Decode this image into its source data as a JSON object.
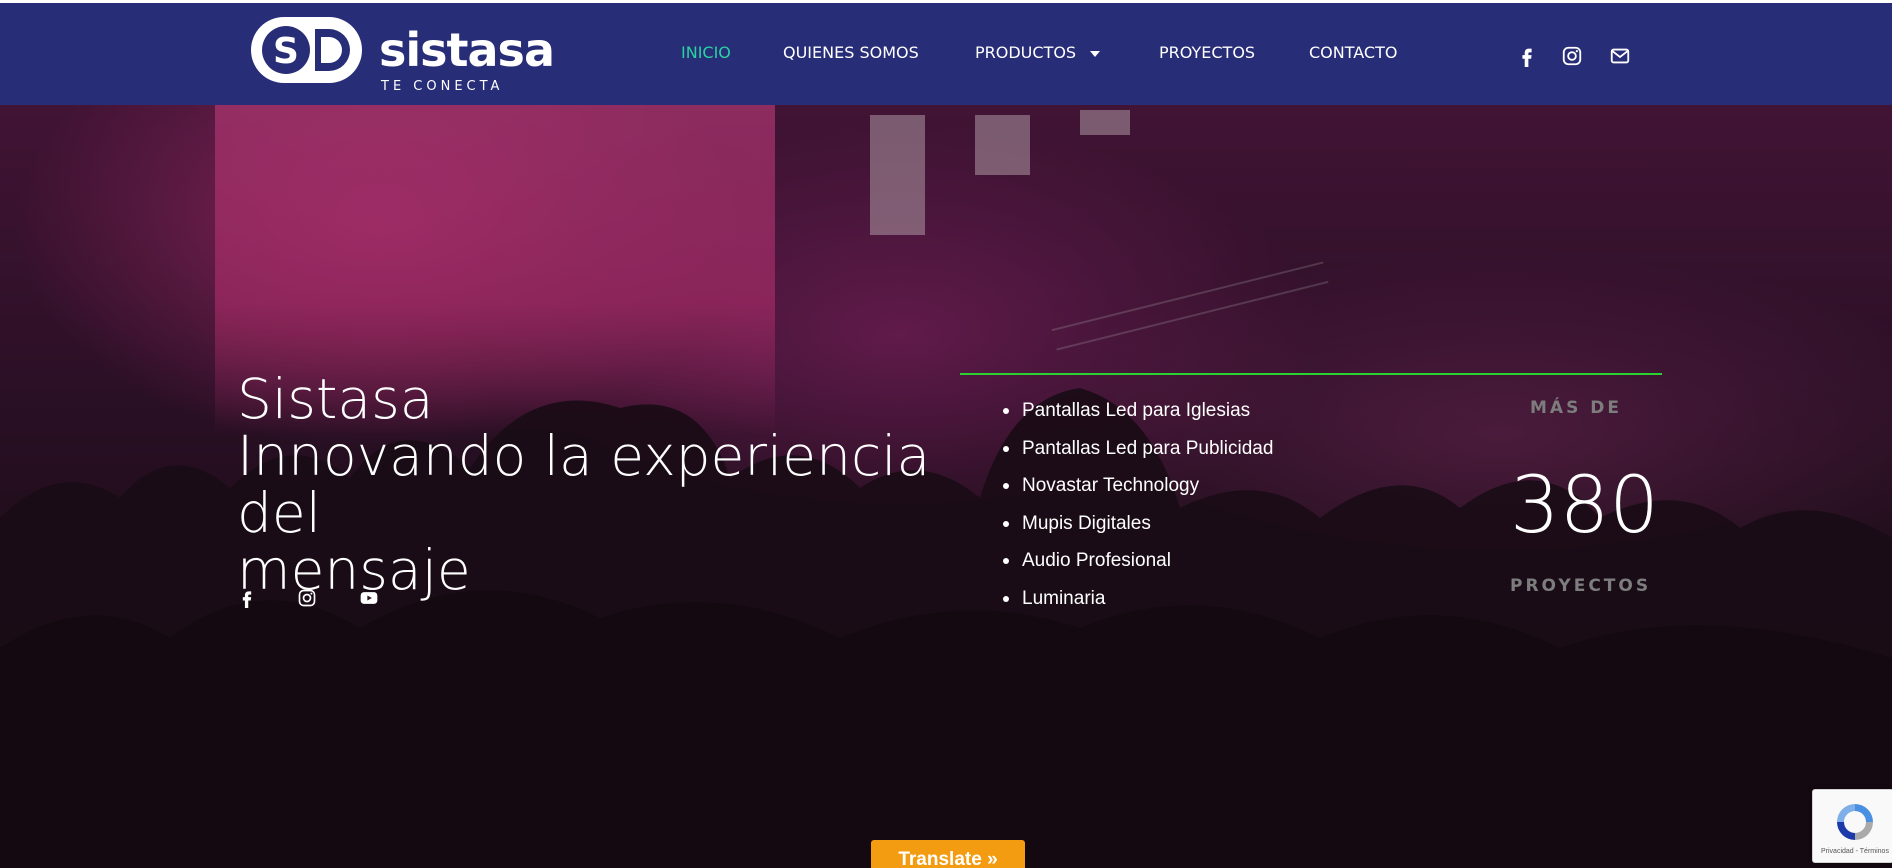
{
  "header": {
    "logo_text": "sistasa",
    "logo_tagline": "TE CONECTA",
    "nav": [
      {
        "label": "INICIO",
        "active": true
      },
      {
        "label": "QUIENES SOMOS",
        "active": false
      },
      {
        "label": "PRODUCTOS",
        "active": false,
        "has_dropdown": true
      },
      {
        "label": "PROYECTOS",
        "active": false
      },
      {
        "label": "CONTACTO",
        "active": false
      }
    ],
    "social_icons": [
      "facebook-icon",
      "instagram-icon",
      "email-icon"
    ]
  },
  "hero": {
    "title_line1": "Sistasa",
    "title_line2": "Innovando la experiencia del",
    "title_line3": "mensaje",
    "social_icons": [
      "facebook-icon",
      "instagram-icon",
      "youtube-icon"
    ],
    "services": [
      "Pantallas Led para Iglesias",
      "Pantallas Led para Publicidad",
      "Novastar Technology",
      "Mupis Digitales",
      "Audio Profesional",
      "Luminaria"
    ],
    "counter_prefix": "MÁS DE",
    "counter_value": "380",
    "counter_label": "PROYECTOS"
  },
  "translate_button": "Translate »",
  "recaptcha": {
    "footer": "Privacidad - Términos"
  },
  "colors": {
    "header_bg": "#282d77",
    "active_nav": "#28d3a0",
    "divider": "#2ad131",
    "translate_bg": "#f39c12"
  }
}
